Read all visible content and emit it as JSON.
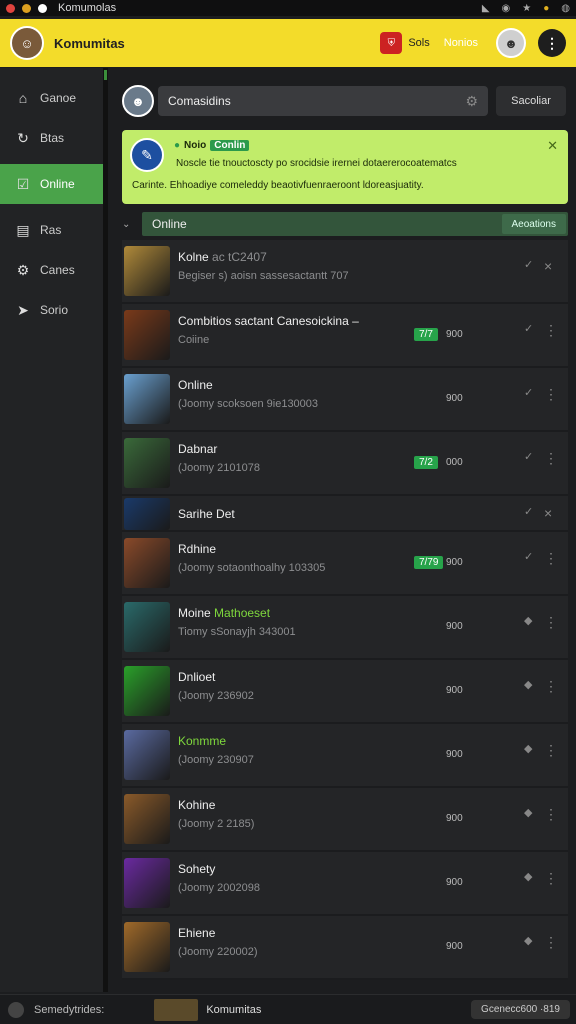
{
  "window": {
    "title": "Komumolas"
  },
  "header": {
    "app_title": "Komumitas",
    "status_label": "Sols",
    "status_value": "Nonios",
    "more_label": "⋮"
  },
  "sidebar": {
    "items": [
      {
        "label": "Ganoe",
        "icon": "home-icon"
      },
      {
        "label": "Btas",
        "icon": "refresh-icon"
      },
      {
        "label": "Online",
        "icon": "check-square-icon"
      },
      {
        "label": "Ras",
        "icon": "grid-icon"
      },
      {
        "label": "Canes",
        "icon": "gear-icon"
      },
      {
        "label": "Sorio",
        "icon": "send-icon"
      }
    ]
  },
  "search": {
    "value": "Comasidins",
    "button": "Sacoliar"
  },
  "notice": {
    "title": "Noio",
    "tag": "Conlin",
    "line1": "Noscle tie tnouctoscty po srocidsie irernei dotaererocoatematcs",
    "line2": "Carinte. Ehhoadiye comeleddy beaotivfuenraeroont ldoreasjuatity."
  },
  "section": {
    "title": "Online",
    "actions": "Aeoations"
  },
  "list": [
    {
      "name": "Kolne",
      "name_suffix": " ac tC2407",
      "sub": "Begiser s) aoisn sassesactantt 707",
      "count": "",
      "num": "",
      "compact": false,
      "thumb_color": "#b08a3a"
    },
    {
      "name": "Combitios sactant Canesoickina –",
      "name_suffix": "",
      "sub": "Coiine",
      "count": "7/7",
      "num": "900",
      "compact": false,
      "thumb_color": "#7a3a1a"
    },
    {
      "name": "Online",
      "name_suffix": "",
      "sub": "(Joomy scoksoen 9ie130003",
      "count": "",
      "num": "900",
      "compact": false,
      "thumb_color": "#6aa0d0"
    },
    {
      "name": "Dabnar",
      "name_suffix": "",
      "sub": "(Joomy 2101078",
      "count": "7/2",
      "num": "000",
      "compact": false,
      "thumb_color": "#3a6a3a"
    },
    {
      "name": "Sarihe Det",
      "name_suffix": "",
      "sub": "",
      "count": "",
      "num": "",
      "compact": true,
      "thumb_color": "#1a3a6a"
    },
    {
      "name": "Rdhine",
      "name_suffix": "",
      "sub": "(Joomy sotaonthoalhy 103305",
      "count": "7/79",
      "num": "900",
      "compact": false,
      "thumb_color": "#8a4a2a"
    },
    {
      "name": "Moine",
      "name_suffix": " Mathoeset",
      "sub": "Tiomy sSonayjh 343001",
      "count": "",
      "num": "900",
      "compact": false,
      "thumb_color": "#2a6a6a"
    },
    {
      "name": "Dnlioet",
      "name_suffix": "",
      "sub": "(Joomy 236902",
      "count": "",
      "num": "900",
      "compact": false,
      "thumb_color": "#2aa02a"
    },
    {
      "name": "Konmme",
      "name_suffix": "",
      "sub": "(Joomy 230907",
      "count": "",
      "num": "900",
      "compact": false,
      "thumb_color": "#5a6aa0",
      "green": true
    },
    {
      "name": "Kohine",
      "name_suffix": "",
      "sub": "(Joomy 2 2185)",
      "count": "",
      "num": "900",
      "compact": false,
      "thumb_color": "#8a5a2a"
    },
    {
      "name": "Sohety",
      "name_suffix": "",
      "sub": "(Joomy 2002098",
      "count": "",
      "num": "900",
      "compact": false,
      "thumb_color": "#6a2aa0"
    },
    {
      "name": "Ehiene",
      "name_suffix": "",
      "sub": "(Joomy 220002)",
      "count": "",
      "num": "900",
      "compact": false,
      "thumb_color": "#a06a2a"
    }
  ],
  "footer": {
    "left_text": "Semedytrides:",
    "title": "Komumitas",
    "button": "Gcenecc600 ·819"
  }
}
